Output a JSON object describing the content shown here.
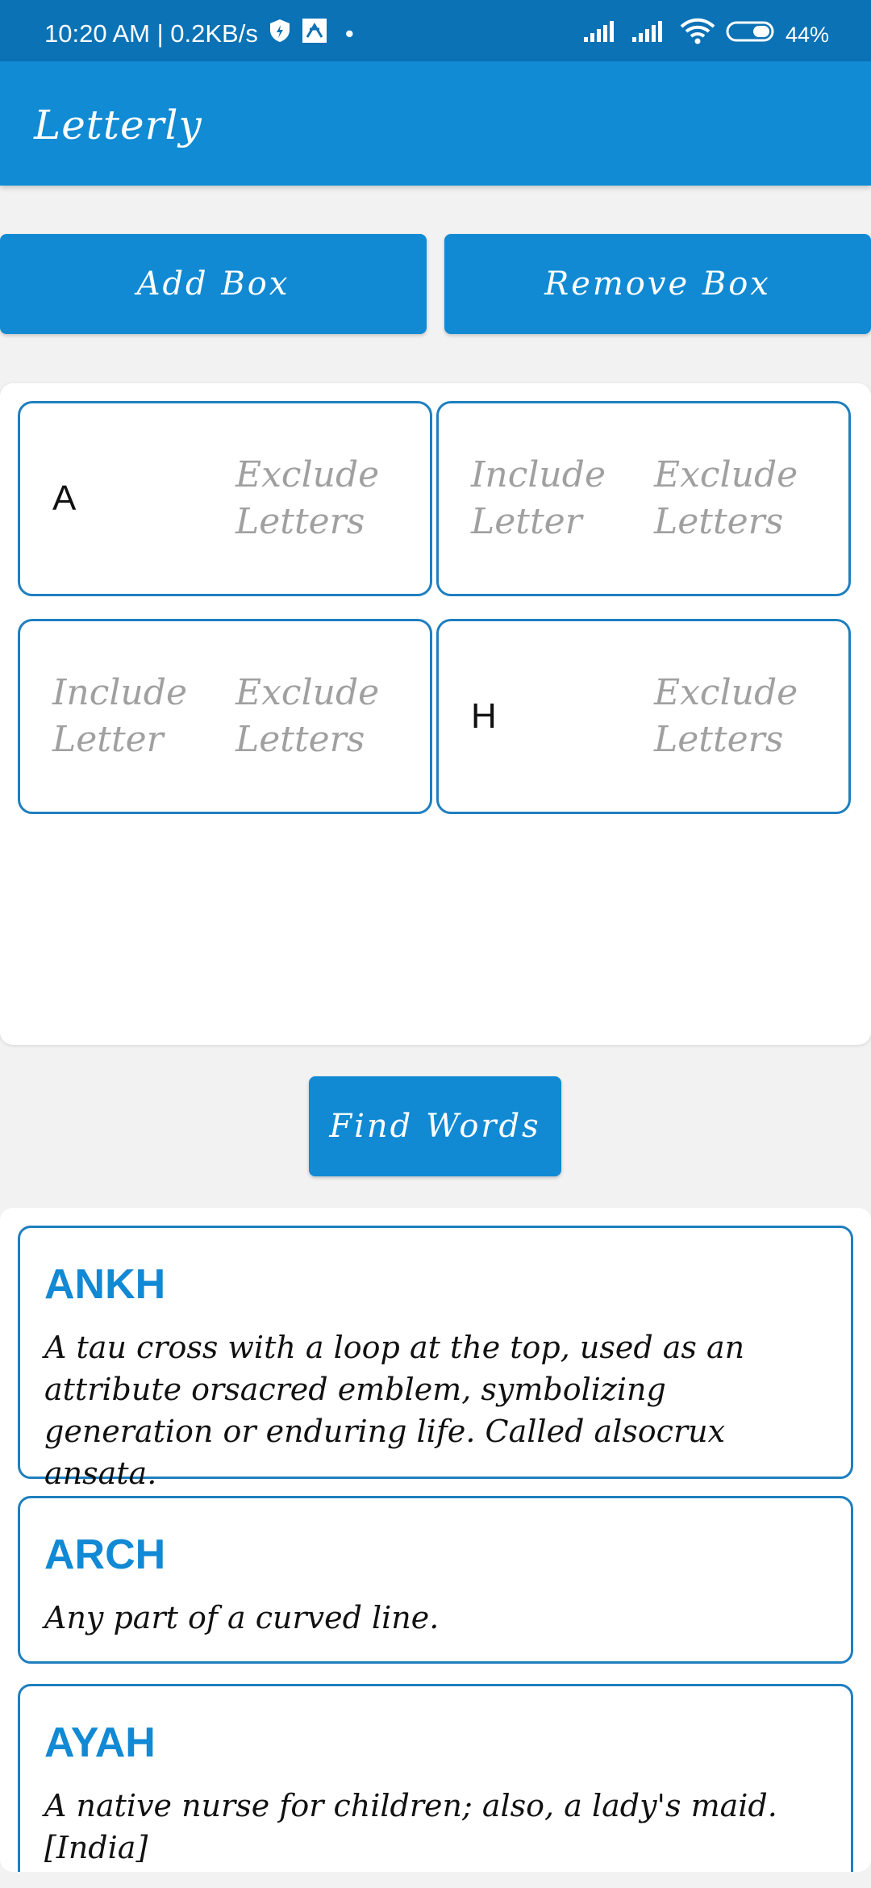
{
  "status": {
    "time_speed": "10:20 AM | 0.2KB/s",
    "dot": "•",
    "battery": "44%"
  },
  "app": {
    "title": "Letterly"
  },
  "controls": {
    "add_box": "Add Box",
    "remove_box": "Remove Box",
    "find_words": "Find Words"
  },
  "boxes": [
    {
      "include": "A",
      "exclude": "Exclude Letters"
    },
    {
      "include": "Include Letter",
      "exclude": "Exclude Letters"
    },
    {
      "include": "Include Letter",
      "exclude": "Exclude Letters"
    },
    {
      "include": "H",
      "exclude": "Exclude Letters"
    }
  ],
  "results": [
    {
      "word": "ANKH",
      "definition": "A tau cross with a loop at the top, used as an attribute orsacred emblem, symbolizing generation or enduring life. Called alsocrux ansata."
    },
    {
      "word": "ARCH",
      "definition": "Any part of a curved line."
    },
    {
      "word": "AYAH",
      "definition": "A native nurse for children; also, a lady's maid. [India]"
    }
  ],
  "colors": {
    "status_bar": "#0b72b5",
    "app_bar": "#108bd4",
    "button": "#118ad3",
    "box_border": "#1f7fbf",
    "word_title": "#1189d4"
  }
}
